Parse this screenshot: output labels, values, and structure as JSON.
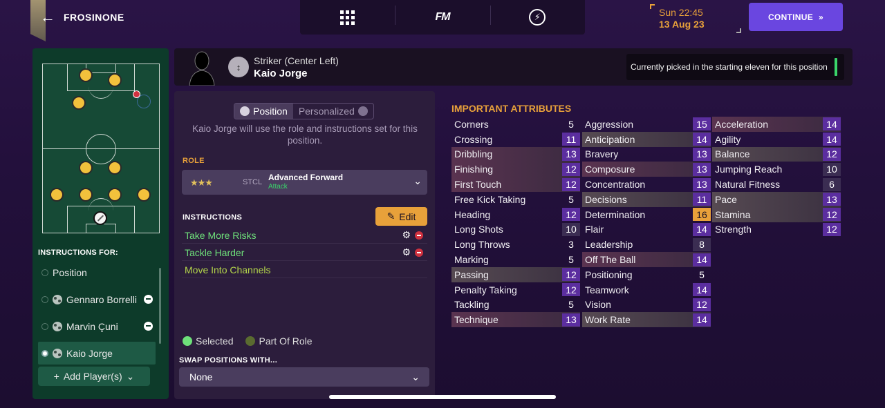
{
  "header": {
    "club_name": "FROSINONE",
    "fm_logo": "FM",
    "date_time": "Sun 22:45",
    "date_date": "13 Aug 23",
    "continue_label": "CONTINUE"
  },
  "player_bar": {
    "position_title": "Striker (Center Left)",
    "player_name": "Kaio Jorge",
    "status_text": "Currently picked in the starting eleven for this position"
  },
  "left_panel": {
    "instructions_for": "INSTRUCTIONS FOR:",
    "items": [
      {
        "label": "Position",
        "selected": false
      },
      {
        "label": "Gennaro Borrelli",
        "selected": false
      },
      {
        "label": "Marvin Çuni",
        "selected": false
      },
      {
        "label": "Kaio Jorge",
        "selected": true
      }
    ],
    "add_player_label": "Add Player(s)"
  },
  "mid_panel": {
    "toggle_position": "Position",
    "toggle_personalized": "Personalized",
    "description": "Kaio Jorge will use the role and instructions set for this position.",
    "role_label": "ROLE",
    "role_stars": "★★★",
    "role_code": "STCL",
    "role_name": "Advanced Forward",
    "role_duty": "Attack",
    "instructions_label": "INSTRUCTIONS",
    "edit_label": "Edit",
    "instructions": [
      {
        "label": "Take More Risks",
        "state": "selected"
      },
      {
        "label": "Tackle Harder",
        "state": "selected"
      },
      {
        "label": "Move Into Channels",
        "state": "part"
      }
    ],
    "legend_selected": "Selected",
    "legend_part": "Part Of Role",
    "swap_label": "SWAP POSITIONS WITH...",
    "swap_value": "None"
  },
  "attributes": {
    "title": "IMPORTANT ATTRIBUTES",
    "columns": [
      [
        {
          "name": "Corners",
          "value": "5",
          "hl": ""
        },
        {
          "name": "Crossing",
          "value": "11",
          "hl": ""
        },
        {
          "name": "Dribbling",
          "value": "13",
          "hl": "key"
        },
        {
          "name": "Finishing",
          "value": "12",
          "hl": "key"
        },
        {
          "name": "First Touch",
          "value": "12",
          "hl": "key"
        },
        {
          "name": "Free Kick Taking",
          "value": "5",
          "hl": ""
        },
        {
          "name": "Heading",
          "value": "12",
          "hl": ""
        },
        {
          "name": "Long Shots",
          "value": "10",
          "hl": ""
        },
        {
          "name": "Long Throws",
          "value": "3",
          "hl": ""
        },
        {
          "name": "Marking",
          "value": "5",
          "hl": ""
        },
        {
          "name": "Passing",
          "value": "12",
          "hl": "pref"
        },
        {
          "name": "Penalty Taking",
          "value": "12",
          "hl": ""
        },
        {
          "name": "Tackling",
          "value": "5",
          "hl": ""
        },
        {
          "name": "Technique",
          "value": "13",
          "hl": "key"
        }
      ],
      [
        {
          "name": "Aggression",
          "value": "15",
          "hl": ""
        },
        {
          "name": "Anticipation",
          "value": "14",
          "hl": "pref"
        },
        {
          "name": "Bravery",
          "value": "13",
          "hl": ""
        },
        {
          "name": "Composure",
          "value": "13",
          "hl": "key"
        },
        {
          "name": "Concentration",
          "value": "13",
          "hl": ""
        },
        {
          "name": "Decisions",
          "value": "11",
          "hl": "pref"
        },
        {
          "name": "Determination",
          "value": "16",
          "hl": ""
        },
        {
          "name": "Flair",
          "value": "14",
          "hl": ""
        },
        {
          "name": "Leadership",
          "value": "8",
          "hl": ""
        },
        {
          "name": "Off The Ball",
          "value": "14",
          "hl": "key"
        },
        {
          "name": "Positioning",
          "value": "5",
          "hl": ""
        },
        {
          "name": "Teamwork",
          "value": "14",
          "hl": ""
        },
        {
          "name": "Vision",
          "value": "12",
          "hl": ""
        },
        {
          "name": "Work Rate",
          "value": "14",
          "hl": "pref"
        }
      ],
      [
        {
          "name": "Acceleration",
          "value": "14",
          "hl": "key"
        },
        {
          "name": "Agility",
          "value": "14",
          "hl": ""
        },
        {
          "name": "Balance",
          "value": "12",
          "hl": "pref"
        },
        {
          "name": "Jumping Reach",
          "value": "10",
          "hl": ""
        },
        {
          "name": "Natural Fitness",
          "value": "6",
          "hl": ""
        },
        {
          "name": "Pace",
          "value": "13",
          "hl": "pref"
        },
        {
          "name": "Stamina",
          "value": "12",
          "hl": "pref"
        },
        {
          "name": "Strength",
          "value": "12",
          "hl": ""
        }
      ]
    ]
  },
  "colors": {
    "accent": "#6a46e0",
    "orange": "#e8a13a",
    "selected_green": "#6ee07a",
    "part_green": "#b4d64a",
    "pitch": "#164a36"
  }
}
